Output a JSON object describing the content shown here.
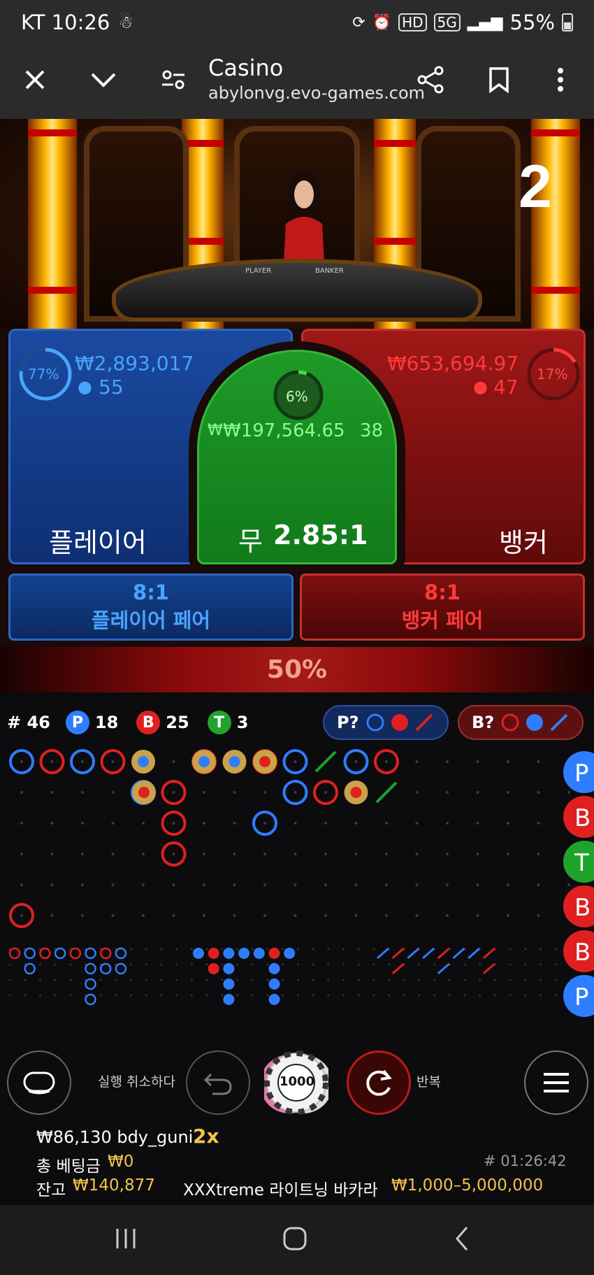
{
  "status_bar": {
    "carrier_time": "KT 10:26",
    "battery": "55%",
    "hd": "HD",
    "net": "5G"
  },
  "browser": {
    "title": "Casino",
    "url": "abylonvg.evo-games.com"
  },
  "video": {
    "table_count": "2",
    "felt_player": "PLAYER",
    "felt_banker": "BANKER"
  },
  "bets": {
    "player": {
      "percent": "77%",
      "amount": "₩2,893,017",
      "players": "55",
      "label": "플레이어"
    },
    "tie": {
      "percent": "6%",
      "amount": "₩197,564.65",
      "players": "38",
      "label": "무",
      "payout": "2.85:1"
    },
    "banker": {
      "percent": "17%",
      "amount": "₩653,694.97",
      "players": "47",
      "label": "뱅커"
    },
    "player_pair": {
      "payout": "8:1",
      "label": "플레이어 페어"
    },
    "banker_pair": {
      "payout": "8:1",
      "label": "뱅커 페어"
    },
    "multiplier_bar": "50%"
  },
  "stats": {
    "round_label": "# 46",
    "p_count": "18",
    "b_count": "25",
    "t_count": "3",
    "p_letter": "P",
    "b_letter": "B",
    "t_letter": "T",
    "ask_player": "P?",
    "ask_banker": "B?"
  },
  "side_buttons": [
    "P",
    "B",
    "T",
    "B",
    "B",
    "P"
  ],
  "controls": {
    "undo_label": "실행 취소하다",
    "repeat_label": "반복",
    "chip_value": "1000"
  },
  "info": {
    "last_win": "₩86,130 bdy_guni",
    "last_win_mult": "2x",
    "total_bet_label": "총 베팅금",
    "total_bet": "₩0",
    "game_id": "# 01:26:42",
    "balance_label": "잔고",
    "balance": "₩140,877",
    "table_name": "XXXtreme 라이트닝 바카라",
    "limits": "₩1,000–5,000,000"
  },
  "colors": {
    "player": "#2f7dff",
    "banker": "#e02020",
    "tie": "#1fa32a",
    "gold": "#f3c34d"
  }
}
